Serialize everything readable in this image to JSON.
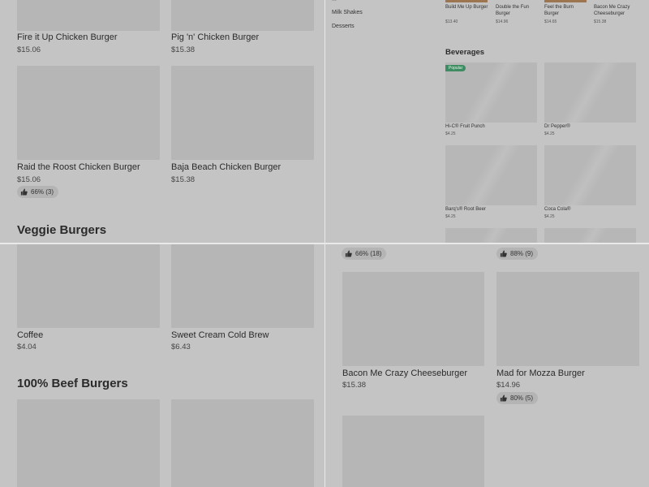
{
  "top_left": {
    "items": [
      {
        "name": "Fire it Up Chicken Burger",
        "price": "$15.06"
      },
      {
        "name": "Pig 'n' Chicken Burger",
        "price": "$15.38"
      },
      {
        "name": "Raid the Roost Chicken Burger",
        "price": "$15.06",
        "rating": "66% (3)"
      },
      {
        "name": "Baja Beach Chicken Burger",
        "price": "$15.38"
      }
    ],
    "section_heading": "Veggie Burgers"
  },
  "top_right": {
    "sidebar": [
      "Milk Shakes",
      "Desserts"
    ],
    "top_items": [
      {
        "name": "Build Me Up Burger",
        "price": "$13.40"
      },
      {
        "name": "Double the Fun Burger",
        "price": "$14.96"
      },
      {
        "name": "Feel the Burn Burger",
        "price": "$14.65"
      },
      {
        "name": "Bacon Me Crazy Cheeseburger",
        "price": "$15.38"
      }
    ],
    "beverages_title": "Beverages",
    "popular_label": "Popular",
    "beverages": [
      {
        "name": "Hi-C® Fruit Punch",
        "price": "$4.25"
      },
      {
        "name": "Dr Pepper®",
        "price": "$4.25"
      },
      {
        "name": "Barq's® Root Beer",
        "price": "$4.25"
      },
      {
        "name": "Coca Cola®",
        "price": "$4.25"
      }
    ]
  },
  "bottom_left": {
    "items": [
      {
        "name": "Coffee",
        "price": "$4.04"
      },
      {
        "name": "Sweet Cream Cold Brew",
        "price": "$6.43"
      }
    ],
    "section_heading": "100% Beef Burgers"
  },
  "bottom_right": {
    "top_ratings": [
      "66% (18)",
      "88% (9)"
    ],
    "items": [
      {
        "name": "Bacon Me Crazy Cheeseburger",
        "price": "$15.38"
      },
      {
        "name": "Mad for Mozza Burger",
        "price": "$14.96",
        "rating": "80% (5)"
      }
    ]
  },
  "colors": {
    "popular_badge": "#3f8c63",
    "divider": "#e9e9e9",
    "background": "#c4c4c4"
  }
}
